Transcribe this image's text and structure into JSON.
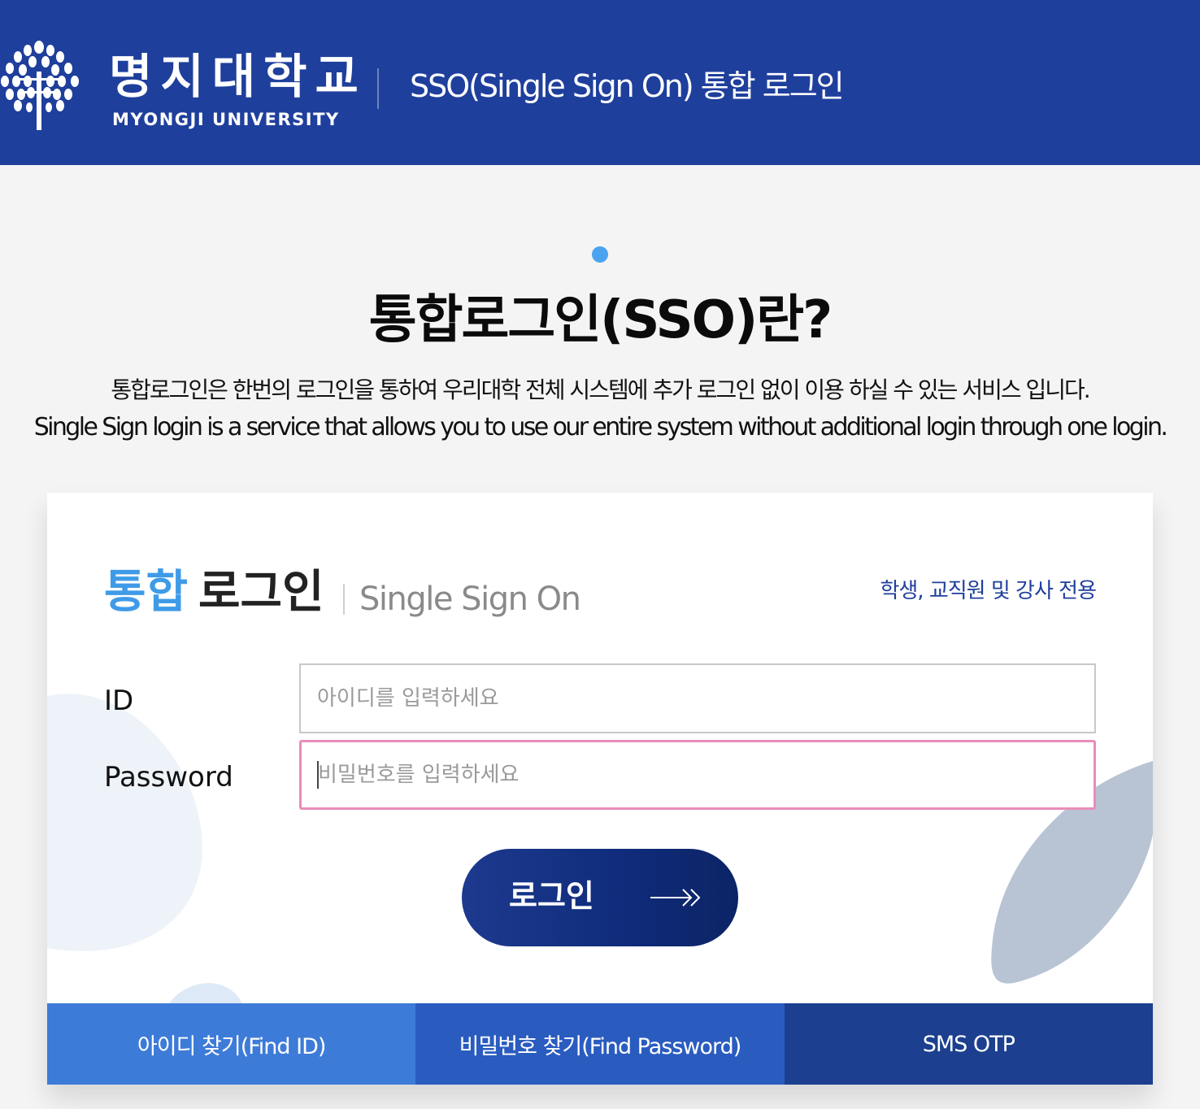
{
  "colors": {
    "header_bg": "#1f3f9c",
    "accent_blue": "#3f9be8",
    "focus_border": "#e88db8",
    "login_button": "#0f2b7a",
    "find_id_bg": "#3d7bd8",
    "find_pw_bg": "#2a5cc0",
    "sms_otp_bg": "#1c3f8f"
  },
  "header": {
    "logo_icon": "tree-icon",
    "logo_korean": "명지대학교",
    "logo_english": "MYONGJI UNIVERSITY",
    "title": "SSO(Single Sign On) 통합 로그인"
  },
  "intro": {
    "title": "통합로그인(SSO)란?",
    "desc_ko": "통합로그인은 한번의 로그인을 통하여 우리대학 전체 시스템에 추가 로그인 없이 이용 하실 수 있는 서비스 입니다.",
    "desc_en": "Single Sign login is a service that allows you to use our entire system without additional login through one login."
  },
  "login_card": {
    "title_highlight": "통합",
    "title_rest": "로그인",
    "subtitle": "Single Sign On",
    "audience_note": "학생, 교직원 및 강사 전용",
    "id_label": "ID",
    "id_placeholder": "아이디를 입력하세요",
    "id_value": "",
    "password_label": "Password",
    "password_placeholder": "비밀번호를 입력하세요",
    "password_value": "",
    "login_button_label": "로그인",
    "login_button_icon": "arrow-right-icon"
  },
  "bottom_links": {
    "find_id": "아이디 찾기(Find ID)",
    "find_password": "비밀번호 찾기(Find Password)",
    "sms_otp": "SMS OTP"
  }
}
